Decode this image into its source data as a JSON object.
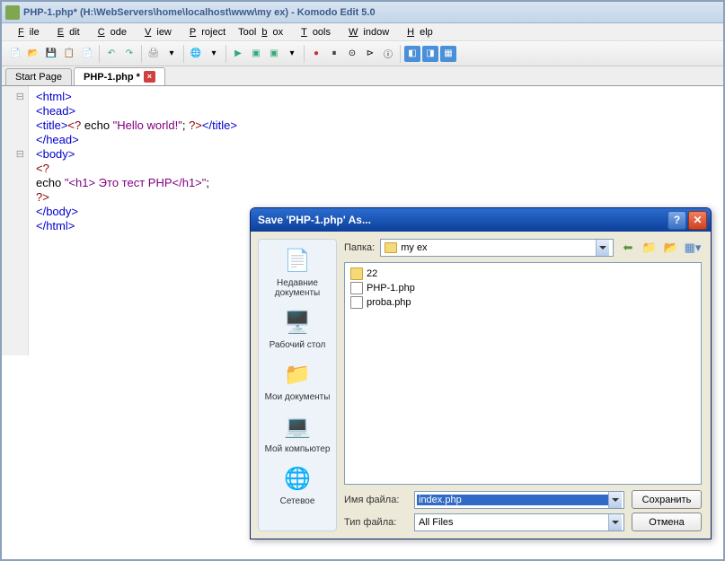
{
  "window": {
    "title": "PHP-1.php* (H:\\WebServers\\home\\localhost\\www\\my ex) - Komodo Edit 5.0"
  },
  "menu": {
    "items": [
      "File",
      "Edit",
      "Code",
      "View",
      "Project",
      "Toolbox",
      "Tools",
      "Window",
      "Help"
    ]
  },
  "tabs": {
    "start": "Start Page",
    "active": "PHP-1.php *"
  },
  "code_lines": [
    {
      "raw": "<html>",
      "cls": "c-tag"
    },
    {
      "raw": "<head>",
      "cls": "c-tag"
    },
    {
      "seg": [
        {
          "t": "<title>",
          "c": "c-tag"
        },
        {
          "t": "<?",
          "c": "c-kw"
        },
        {
          "t": " echo ",
          "c": "c-txt"
        },
        {
          "t": "\"Hello world!\"",
          "c": "c-str"
        },
        {
          "t": "; ",
          "c": "c-txt"
        },
        {
          "t": "?>",
          "c": "c-kw"
        },
        {
          "t": "</title>",
          "c": "c-tag"
        }
      ]
    },
    {
      "raw": "</head>",
      "cls": "c-tag"
    },
    {
      "raw": "<body>",
      "cls": "c-tag"
    },
    {
      "raw": "<?",
      "cls": "c-kw"
    },
    {
      "seg": [
        {
          "t": "echo ",
          "c": "c-txt"
        },
        {
          "t": "\"<h1> Это тест PHP</h1>\"",
          "c": "c-str"
        },
        {
          "t": ";",
          "c": "c-txt"
        }
      ]
    },
    {
      "raw": "?>",
      "cls": "c-kw"
    },
    {
      "raw": "</body>",
      "cls": "c-tag"
    },
    {
      "raw": "</html>",
      "cls": "c-tag"
    }
  ],
  "dialog": {
    "title": "Save 'PHP-1.php' As...",
    "folder_label": "Папка:",
    "folder_value": "my ex",
    "places": [
      {
        "icon": "📄",
        "label": "Недавние\nдокументы"
      },
      {
        "icon": "🖥️",
        "label": "Рабочий стол"
      },
      {
        "icon": "📁",
        "label": "Мои документы"
      },
      {
        "icon": "💻",
        "label": "Мой\nкомпьютер"
      },
      {
        "icon": "🌐",
        "label": "Сетевое"
      }
    ],
    "files": [
      {
        "name": "22",
        "type": "folder"
      },
      {
        "name": "PHP-1.php",
        "type": "file"
      },
      {
        "name": "proba.php",
        "type": "file"
      }
    ],
    "filename_label": "Имя файла:",
    "filename_value": "index.php",
    "filetype_label": "Тип файла:",
    "filetype_value": "All Files",
    "save_btn": "Сохранить",
    "cancel_btn": "Отмена"
  }
}
